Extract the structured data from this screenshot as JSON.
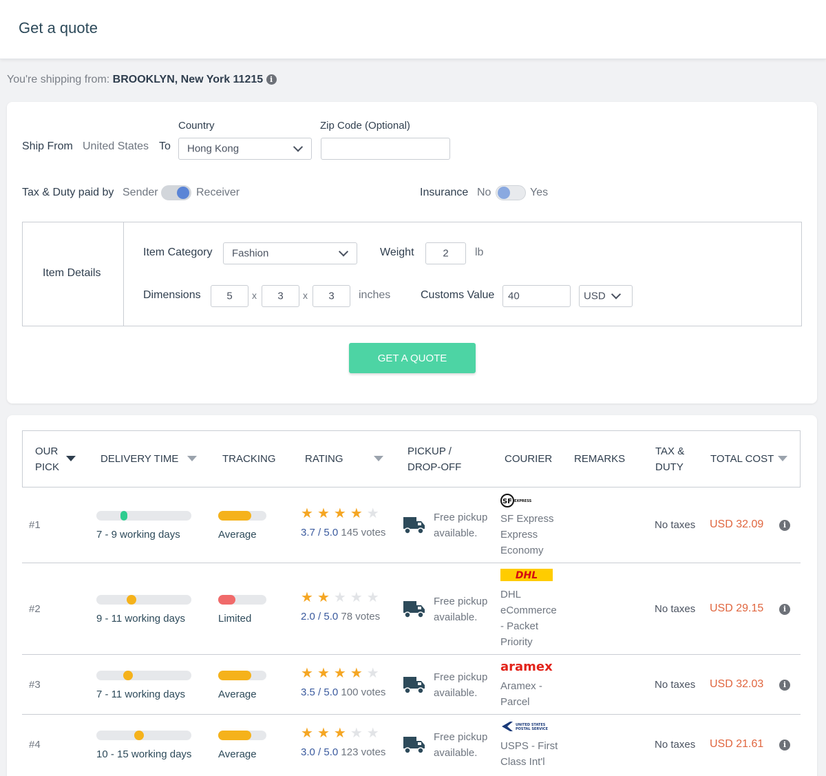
{
  "header": {
    "title": "Get a quote"
  },
  "shipping_from": {
    "prefix": "You're shipping from:",
    "location": "BROOKLYN, New York 11215"
  },
  "form": {
    "ship_from_label": "Ship From",
    "ship_from_value": "United States",
    "to_label": "To",
    "country_label": "Country",
    "country_value": "Hong Kong",
    "zip_label": "Zip Code (Optional)",
    "zip_value": "",
    "tax_label": "Tax & Duty paid by",
    "tax_left": "Sender",
    "tax_right": "Receiver",
    "tax_selected": "Receiver",
    "insurance_label": "Insurance",
    "insurance_left": "No",
    "insurance_right": "Yes",
    "insurance_selected": "No",
    "item_details_label": "Item Details",
    "item_category_label": "Item Category",
    "item_category_value": "Fashion",
    "weight_label": "Weight",
    "weight_value": "2",
    "weight_unit": "lb",
    "dimensions_label": "Dimensions",
    "dim_1": "5",
    "dim_2": "3",
    "dim_3": "3",
    "dim_sep": "x",
    "dim_unit": "inches",
    "customs_label": "Customs Value",
    "customs_value": "40",
    "currency": "USD",
    "quote_button": "GET A QUOTE"
  },
  "table": {
    "headers": {
      "pick_1": "OUR",
      "pick_2": "PICK",
      "delivery": "DELIVERY TIME",
      "tracking": "TRACKING",
      "rating": "RATING",
      "pickup_1": "PICKUP /",
      "pickup_2": "DROP-OFF",
      "courier": "COURIER",
      "remarks": "REMARKS",
      "tax_1": "TAX &",
      "tax_2": "DUTY",
      "total": "TOTAL COST"
    },
    "rows": [
      {
        "rank": "#1",
        "delivery": "7 - 9 working days",
        "delivery_level": 0.27,
        "delivery_color": "#2ecc8f",
        "tracking": "Average",
        "tracking_color": "#f5b21b",
        "stars": 3.7,
        "rating": "3.7 / 5.0",
        "votes": "145 votes",
        "pickup_1": "Free pickup",
        "pickup_2": "available.",
        "courier_logo": "SF EXPRESS",
        "courier_1": "SF Express",
        "courier_2": "Express",
        "courier_3": "Economy",
        "courier_4": "",
        "taxes": "No taxes",
        "cost": "USD 32.09"
      },
      {
        "rank": "#2",
        "delivery": "9 - 11 working days",
        "delivery_level": 0.34,
        "delivery_color": "#f5b21b",
        "tracking": "Limited",
        "tracking_color": "#f06a6a",
        "stars": 2.0,
        "rating": "2.0 / 5.0",
        "votes": "78 votes",
        "pickup_1": "Free pickup",
        "pickup_2": "available.",
        "courier_logo": "DHL",
        "courier_1": "DHL",
        "courier_2": "eCommerce",
        "courier_3": "- Packet",
        "courier_4": "Priority",
        "taxes": "No taxes",
        "cost": "USD 29.15"
      },
      {
        "rank": "#3",
        "delivery": "7 - 11 working days",
        "delivery_level": 0.3,
        "delivery_color": "#f5b21b",
        "tracking": "Average",
        "tracking_color": "#f5b21b",
        "stars": 3.5,
        "rating": "3.5 / 5.0",
        "votes": "100 votes",
        "pickup_1": "Free pickup",
        "pickup_2": "available.",
        "courier_logo": "aramex",
        "courier_1": "Aramex -",
        "courier_2": "Parcel",
        "courier_3": "",
        "courier_4": "",
        "taxes": "No taxes",
        "cost": "USD 32.03"
      },
      {
        "rank": "#4",
        "delivery": "10 - 15 working days",
        "delivery_level": 0.42,
        "delivery_color": "#f5b21b",
        "tracking": "Average",
        "tracking_color": "#f5b21b",
        "stars": 3.0,
        "rating": "3.0 / 5.0",
        "votes": "123 votes",
        "pickup_1": "Free pickup",
        "pickup_2": "available.",
        "courier_logo": "UNITED STATES POSTAL SERVICE",
        "courier_1": "USPS - First",
        "courier_2": "Class Int'l",
        "courier_3": "",
        "courier_4": "",
        "taxes": "No taxes",
        "cost": "USD 21.61"
      }
    ]
  }
}
